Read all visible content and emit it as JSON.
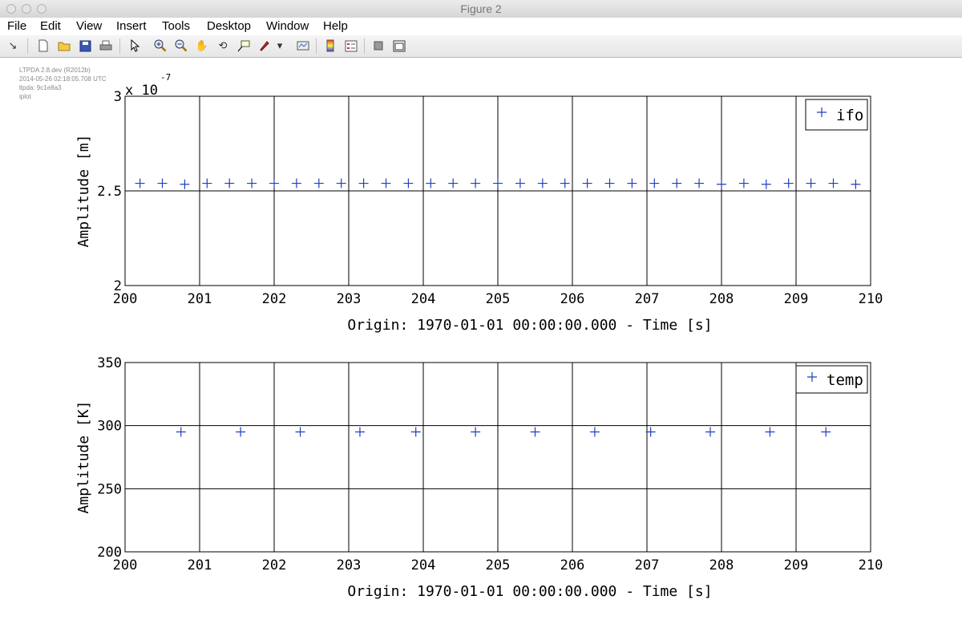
{
  "window": {
    "title": "Figure 2"
  },
  "menu": [
    "File",
    "Edit",
    "View",
    "Insert",
    "Tools",
    "Desktop",
    "Window",
    "Help"
  ],
  "toolbar": {
    "icons": [
      "arrow-icon",
      "new-figure-icon",
      "open-file-icon",
      "save-icon",
      "print-icon",
      "select-pointer-icon",
      "zoom-in-icon",
      "zoom-out-icon",
      "pan-hand-icon",
      "rotate-3d-icon",
      "data-cursor-icon",
      "brush-icon",
      "brush-dropdown-icon",
      "link-plot-icon",
      "colorbar-icon",
      "legend-icon",
      "hide-plot-tools-icon",
      "show-plot-tools-icon"
    ]
  },
  "stamp": {
    "line1": "LTPDA 2.8.dev (R2012b)",
    "line2": "2014-05-26 02:18:05.708 UTC",
    "line3": "ltpda: 9c1e8a3",
    "line4": "iplot"
  },
  "colors": {
    "marker": "#1f3fc4",
    "axis": "#000000",
    "grid": "#000000"
  },
  "chart_data": [
    {
      "type": "scatter",
      "marker": "+",
      "xlabel": "Origin: 1970-01-01 00:00:00.000 - Time  [s]",
      "ylabel": "Amplitude  [m]",
      "exponent_base": "x 10",
      "exponent_power": "-7",
      "xlim": [
        200,
        210
      ],
      "ylim": [
        2e-07,
        3e-07
      ],
      "xticks": [
        "200",
        "201",
        "202",
        "203",
        "204",
        "205",
        "206",
        "207",
        "208",
        "209",
        "210"
      ],
      "yticks": [
        "2",
        "2.5",
        "3"
      ],
      "ytick_values": [
        2e-07,
        2.5e-07,
        3e-07
      ],
      "grid": true,
      "legend_position": "top-right",
      "series": [
        {
          "name": "ifo",
          "x": [
            200.2,
            200.5,
            200.8,
            201.1,
            201.4,
            201.7,
            202.0,
            202.3,
            202.6,
            202.9,
            203.2,
            203.5,
            203.8,
            204.1,
            204.4,
            204.7,
            205.0,
            205.3,
            205.6,
            205.9,
            206.2,
            206.5,
            206.8,
            207.1,
            207.4,
            207.7,
            208.0,
            208.3,
            208.6,
            208.9,
            209.2,
            209.5,
            209.8
          ],
          "y": [
            2.54e-07,
            2.54e-07,
            2.535e-07,
            2.54e-07,
            2.54e-07,
            2.54e-07,
            2.54e-07,
            2.54e-07,
            2.54e-07,
            2.54e-07,
            2.54e-07,
            2.54e-07,
            2.54e-07,
            2.54e-07,
            2.54e-07,
            2.54e-07,
            2.54e-07,
            2.54e-07,
            2.54e-07,
            2.54e-07,
            2.54e-07,
            2.54e-07,
            2.54e-07,
            2.54e-07,
            2.54e-07,
            2.54e-07,
            2.535e-07,
            2.54e-07,
            2.535e-07,
            2.54e-07,
            2.54e-07,
            2.54e-07,
            2.535e-07
          ]
        }
      ]
    },
    {
      "type": "scatter",
      "marker": "+",
      "xlabel": "Origin: 1970-01-01 00:00:00.000 - Time  [s]",
      "ylabel": "Amplitude  [K]",
      "xlim": [
        200,
        210
      ],
      "ylim": [
        200,
        350
      ],
      "xticks": [
        "200",
        "201",
        "202",
        "203",
        "204",
        "205",
        "206",
        "207",
        "208",
        "209",
        "210"
      ],
      "yticks": [
        "200",
        "250",
        "300",
        "350"
      ],
      "ytick_values": [
        200,
        250,
        300,
        350
      ],
      "grid": true,
      "legend_position": "top-right",
      "series": [
        {
          "name": "temp",
          "x": [
            200.75,
            201.55,
            202.35,
            203.15,
            203.9,
            204.7,
            205.5,
            206.3,
            207.05,
            207.85,
            208.65,
            209.4
          ],
          "y": [
            295,
            295,
            295,
            295,
            295,
            295,
            295,
            295,
            295,
            295,
            295,
            295
          ]
        }
      ]
    }
  ]
}
